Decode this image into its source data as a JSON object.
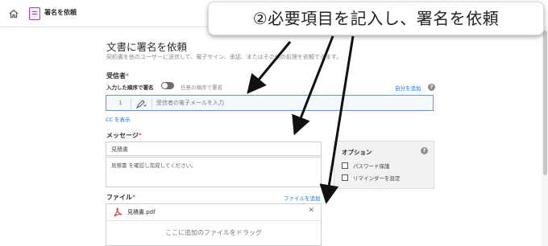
{
  "topbar": {
    "tab_title": "署名を依頼"
  },
  "annotation": {
    "text": "②必要項目を記入し、署名を依頼"
  },
  "page": {
    "heading": "文書に署名を依頼",
    "subheading": "契約書を他のユーザーに送信して、電子サイン、承認、またはその他の処理を依頼できます。"
  },
  "recipients": {
    "label": "受信者",
    "required_mark": "*",
    "order_label": "入力した順序で署名",
    "any_order_label": "任意の順序で署名",
    "add_me_link": "自分を追加",
    "row_number": "1",
    "email_placeholder": "受信者の電子メールを入力",
    "cc_link": "CC を表示"
  },
  "message": {
    "label": "メッセージ",
    "required_mark": "*",
    "subject_value": "見積書",
    "body_value": "見積書 を確認し完成してください。"
  },
  "options": {
    "title": "オプション",
    "items": [
      {
        "label": "パスワード保護"
      },
      {
        "label": "リマインダーを設定"
      }
    ]
  },
  "files": {
    "label": "ファイル",
    "required_mark": "*",
    "add_link": "ファイルを追加",
    "items": [
      {
        "name": "見積書.pdf"
      }
    ],
    "drag_text": "ここに追加のファイルをドラッグ"
  },
  "icons": {
    "home": "home-icon",
    "document": "document-sign-icon",
    "help": "help-icon",
    "pen": "signature-pen-icon",
    "pdf": "pdf-file-icon",
    "remove": "close-icon"
  },
  "colors": {
    "accent_blue": "#1473e6",
    "required_red": "#c23a3a",
    "doc_icon_magenta": "#c23a8f"
  }
}
